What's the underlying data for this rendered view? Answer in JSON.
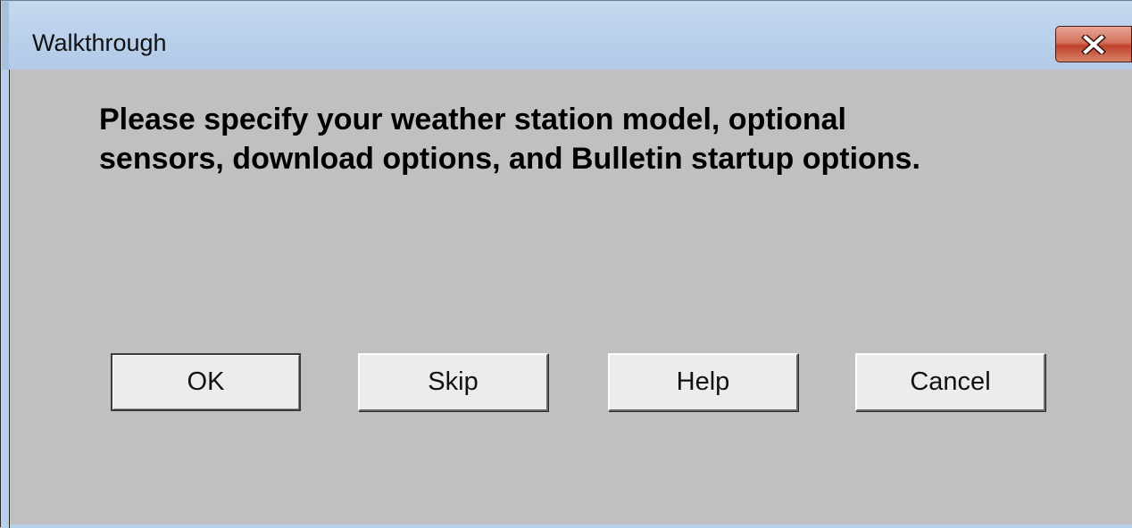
{
  "window": {
    "title": "Walkthrough",
    "close_icon": "close-x-icon"
  },
  "dialog": {
    "message_lines": [
      "Please specify your weather station model, optional",
      "sensors, download options, and Bulletin startup options."
    ]
  },
  "buttons": {
    "ok": "OK",
    "skip": "Skip",
    "help": "Help",
    "cancel": "Cancel"
  },
  "colors": {
    "client_background": "#c0c0c0",
    "titlebar": "#bcd2ec",
    "close_button": "#c0432a"
  }
}
